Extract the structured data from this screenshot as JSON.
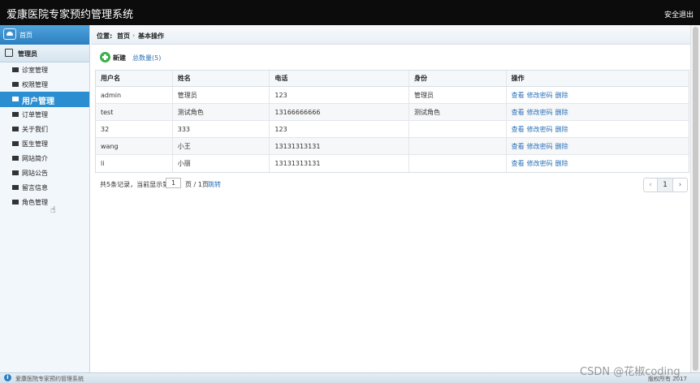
{
  "header": {
    "title": "爱康医院专家预约管理系统",
    "logout": "安全退出"
  },
  "sidebar": {
    "home": "首页",
    "group": "管理员",
    "items": [
      {
        "label": "诊室管理",
        "active": false
      },
      {
        "label": "权限管理",
        "active": false
      },
      {
        "label": "用户管理",
        "active": true
      },
      {
        "label": "订单管理",
        "active": false
      },
      {
        "label": "关于我们",
        "active": false
      },
      {
        "label": "医生管理",
        "active": false
      },
      {
        "label": "网站简介",
        "active": false
      },
      {
        "label": "网站公告",
        "active": false
      },
      {
        "label": "留言信息",
        "active": false
      },
      {
        "label": "角色管理",
        "active": false
      }
    ]
  },
  "breadcrumb": {
    "prefix": "位置:",
    "home": "首页",
    "separator": "›",
    "current": "基本操作"
  },
  "toolbar": {
    "new": "新建",
    "total": "总数量(5)"
  },
  "table": {
    "headers": [
      "用户名",
      "姓名",
      "电话",
      "身份",
      "操作"
    ],
    "rows": [
      {
        "username": "admin",
        "name": "管理员",
        "phone": "123",
        "role": "管理员"
      },
      {
        "username": "test",
        "name": "测试角色",
        "phone": "13166666666",
        "role": "测试角色"
      },
      {
        "username": "32",
        "name": "333",
        "phone": "123",
        "role": ""
      },
      {
        "username": "wang",
        "name": "小王",
        "phone": "13131313131",
        "role": ""
      },
      {
        "username": "li",
        "name": "小丽",
        "phone": "13131313131",
        "role": ""
      }
    ],
    "actions": {
      "view": "查看",
      "change_password": "修改密码",
      "delete": "删除"
    }
  },
  "pagination": {
    "summary": "共5条记录，当前显示第",
    "page_value": "1",
    "of_pages": "页 / 1页",
    "jump": "跳转",
    "prev": "‹",
    "current": "1",
    "next": "›"
  },
  "footer": {
    "info_icon": "i",
    "text": "爱康医院专家预约管理系统",
    "right": "版权所有 2017"
  },
  "watermark": "CSDN @花椒coding",
  "icons": [
    "cloud-home-icon",
    "edit-icon",
    "list-icon",
    "plus-circle-icon",
    "info-icon",
    "cursor-hand-icon"
  ],
  "colors": {
    "topbar": "#0c0c0c",
    "accent": "#2a8ed0",
    "link": "#2a6fb6",
    "new_button": "#3bb04a"
  }
}
